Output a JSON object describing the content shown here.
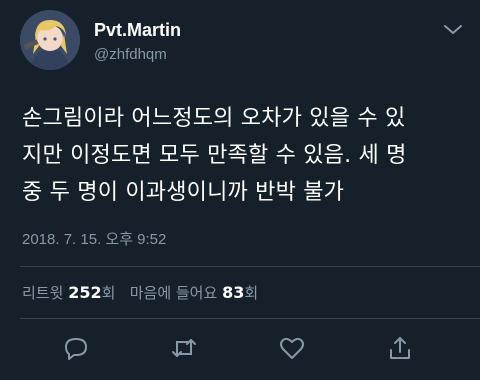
{
  "tweet": {
    "display_name": "Pvt.Martin",
    "handle": "@zhfdhqm",
    "text_lines": [
      "손그림이라 어느정도의 오차가 있을 수 있",
      "지만 이정도면 모두 만족할 수 있음. 세 명",
      "중 두 명이 이과생이니까 반박 불가"
    ],
    "timestamp": "2018. 7. 15. 오후 9:52"
  },
  "stats": {
    "retweets_label": "리트윗",
    "retweets_count": "252",
    "retweets_unit": "회",
    "likes_label": "마음에 들어요",
    "likes_count": "83",
    "likes_unit": "회"
  },
  "icons": {
    "menu": "chevron-down-icon",
    "reply": "reply-icon",
    "retweet": "retweet-icon",
    "like": "heart-icon",
    "share": "share-icon"
  },
  "colors": {
    "background": "#15202b",
    "secondary_text": "#8899a6",
    "divider": "#38444d"
  }
}
